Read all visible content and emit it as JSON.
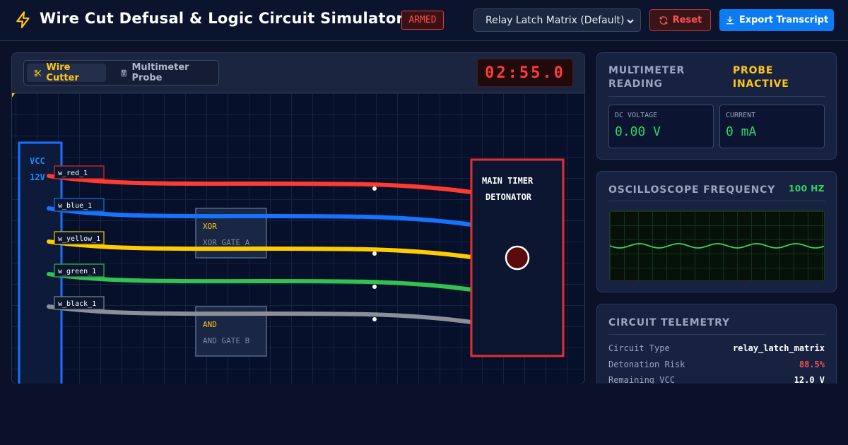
{
  "header": {
    "title": "Wire Cut Defusal & Logic Circuit Simulator",
    "status_badge": "ARMED",
    "circuit_select": {
      "selected": "Relay Latch Matrix (Default)"
    },
    "reset_label": "Reset",
    "export_label": "Export Transcript"
  },
  "toolbar": {
    "tools": [
      {
        "label": "Wire Cutter",
        "icon": "scissors-icon",
        "active": true
      },
      {
        "label": "Multimeter Probe",
        "icon": "multimeter-icon",
        "active": false
      }
    ],
    "timer": "02:55.0"
  },
  "board": {
    "power_rail": {
      "label": "VCC",
      "voltage": "12V"
    },
    "wires": [
      {
        "id": "w_red_1",
        "color": "#ff3b30"
      },
      {
        "id": "w_blue_1",
        "color": "#1673ff"
      },
      {
        "id": "w_yellow_1",
        "color": "#ffcc00"
      },
      {
        "id": "w_green_1",
        "color": "#31c24f"
      },
      {
        "id": "w_black_1",
        "color": "#8a8f99"
      }
    ],
    "gates": [
      {
        "type": "XOR",
        "name": "XOR GATE A"
      },
      {
        "type": "AND",
        "name": "AND GATE B"
      }
    ],
    "detonator": {
      "line1": "MAIN TIMER",
      "line2": "DETONATOR"
    }
  },
  "multimeter": {
    "title": "Multimeter Reading",
    "probe_status": "PROBE INACTIVE",
    "voltage_label": "DC Voltage",
    "voltage_value": "0.00 V",
    "current_label": "Current",
    "current_value": "0 mA"
  },
  "oscilloscope": {
    "title": "Oscilloscope Frequency",
    "frequency": "100 HZ"
  },
  "telemetry": {
    "title": "Circuit Telemetry",
    "rows": [
      {
        "key": "Circuit Type",
        "value": "relay_latch_matrix",
        "color": "#ffffff"
      },
      {
        "key": "Detonation Risk",
        "value": "88.5%",
        "color": "#ff4d4d"
      },
      {
        "key": "Remaining VCC",
        "value": "12.0 V",
        "color": "#ffffff"
      }
    ]
  },
  "colors": {
    "accent": "#0d7cf2",
    "danger": "#ff3b3b",
    "warning": "#ffc61a",
    "ok": "#2fd56a"
  }
}
